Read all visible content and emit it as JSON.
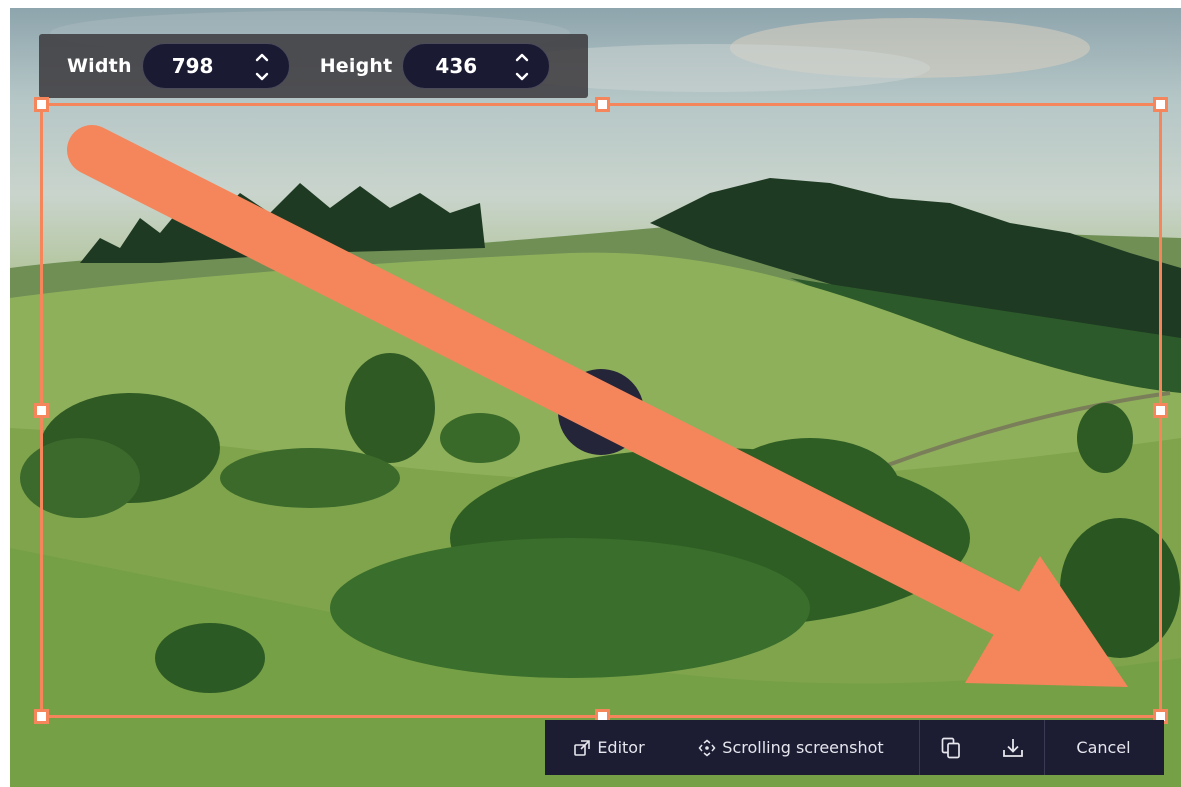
{
  "size_toolbar": {
    "width_label": "Width",
    "width_value": "798",
    "height_label": "Height",
    "height_value": "436"
  },
  "action_bar": {
    "editor_label": "Editor",
    "editor_icon": "external-window-icon",
    "scrolling_label": "Scrolling screenshot",
    "scrolling_icon": "move-arrows-icon",
    "copy_icon": "copy-icon",
    "download_icon": "download-icon",
    "cancel_label": "Cancel"
  },
  "colors": {
    "accent": "#f5855a",
    "toolbar_bg": "#3c3a3e",
    "field_bg": "#1a1a33",
    "action_bar_bg": "#1c1c33"
  }
}
